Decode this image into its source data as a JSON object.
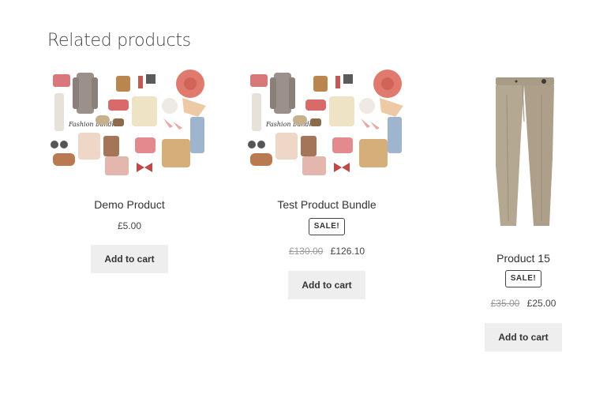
{
  "section": {
    "title": "Related products"
  },
  "products": [
    {
      "title": "Demo Product",
      "price": "£5.00",
      "sale_badge": "",
      "old_price": "",
      "new_price": "",
      "button_label": "Add to cart",
      "image": "fashion-bundle-collage"
    },
    {
      "title": "Test Product Bundle",
      "price": "",
      "sale_badge": "SALE!",
      "old_price": "£130.00",
      "new_price": "£126.10",
      "button_label": "Add to cart",
      "image": "fashion-bundle-collage"
    },
    {
      "title": "Product 15",
      "price": "",
      "sale_badge": "SALE!",
      "old_price": "£35.00",
      "new_price": "£25.00",
      "button_label": "Add to cart",
      "image": "beige-trousers"
    }
  ],
  "collage_text": "Fashion bundle",
  "colors": {
    "button_bg": "#eeeeee",
    "text": "#333333",
    "muted": "#9a9a9a",
    "trouser": "#b5a893"
  }
}
